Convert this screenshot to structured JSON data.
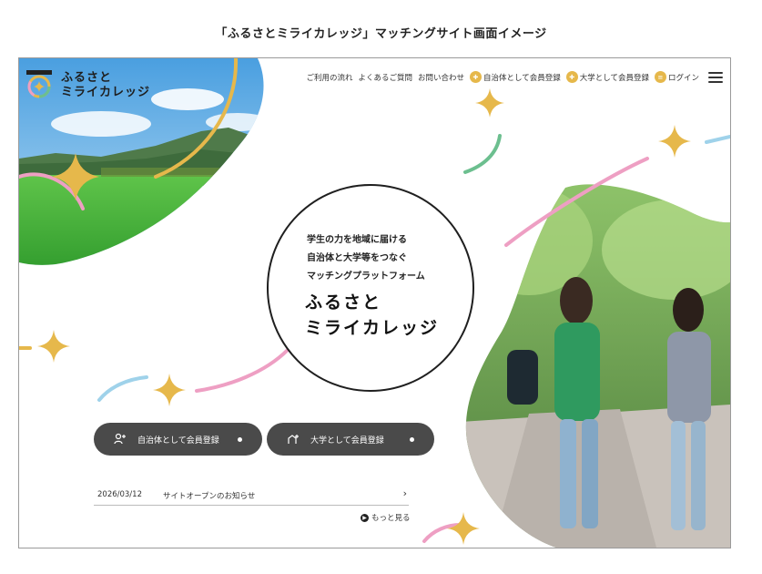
{
  "caption": "「ふるさとミライカレッジ」マッチングサイト画面イメージ",
  "logo": {
    "line1": "ふるさと",
    "line2": "ミライカレッジ"
  },
  "nav": {
    "flow": "ご利用の流れ",
    "faq": "よくあるご質問",
    "contact": "お問い合わせ",
    "municipality_register": "自治体として会員登録",
    "university_register": "大学として会員登録",
    "login": "ログイン"
  },
  "hero": {
    "tagline": [
      "学生の力を地域に届ける",
      "自治体と大学等をつなぐ",
      "マッチングプラットフォーム"
    ],
    "brand_line1": "ふるさと",
    "brand_line2": "ミライカレッジ"
  },
  "cta": {
    "municipality": "自治体として会員登録",
    "university": "大学として会員登録"
  },
  "news": {
    "date": "2026/03/12",
    "title": "サイトオープンのお知らせ",
    "more": "もっと見る"
  },
  "colors": {
    "gold": "#e6b84b",
    "pink": "#ee9fc3",
    "blue": "#9fd2ea",
    "green": "#6cbf8f",
    "button": "#4a4a4a"
  }
}
